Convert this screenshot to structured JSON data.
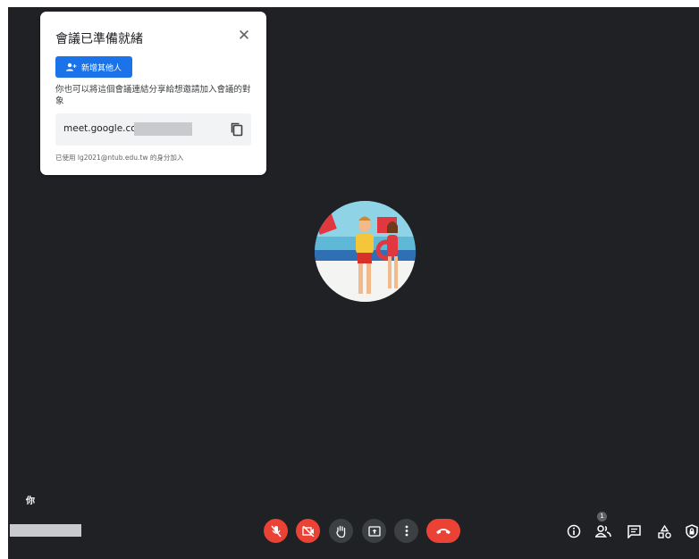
{
  "popup": {
    "title": "會議已準備就緒",
    "add_button_label": "新增其他人",
    "description": "你也可以將這個會議連結分享給想邀請加入會議的對象",
    "meeting_link": "meet.google.com",
    "joined_as": "已使用 lg2021@ntub.edu.tw 的身分加入"
  },
  "stage": {
    "self_label": "你"
  },
  "toolbar": {
    "participant_count": "1",
    "icons": [
      "mic-off-icon",
      "camera-off-icon",
      "raise-hand-icon",
      "present-screen-icon",
      "more-options-icon",
      "hang-up-icon",
      "info-icon",
      "people-icon",
      "chat-icon",
      "activities-icon",
      "host-controls-icon"
    ]
  },
  "colors": {
    "background": "#202124",
    "danger": "#ea4335",
    "primary": "#1a73e8"
  }
}
